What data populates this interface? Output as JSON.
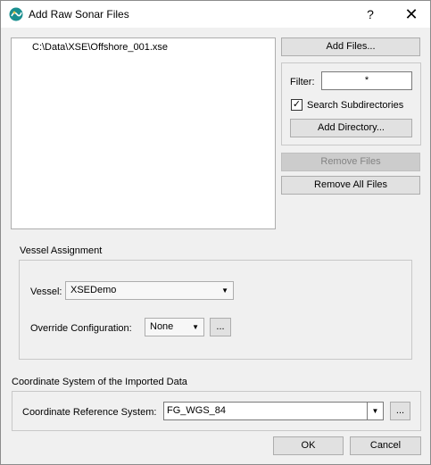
{
  "window": {
    "title": "Add Raw Sonar Files",
    "help": "?",
    "close": "✕"
  },
  "files": {
    "items": [
      "C:\\Data\\XSE\\Offshore_001.xse"
    ]
  },
  "buttons": {
    "add_files": "Add Files...",
    "add_directory": "Add Directory...",
    "remove_files": "Remove Files",
    "remove_all_files": "Remove All Files",
    "ok": "OK",
    "cancel": "Cancel"
  },
  "filter": {
    "label": "Filter:",
    "value": "*",
    "search_subdirectories_label": "Search Subdirectories",
    "search_subdirectories_checked": true,
    "checkmark": "✓"
  },
  "vessel_assignment": {
    "title": "Vessel Assignment",
    "vessel_label": "Vessel:",
    "vessel_value": "XSEDemo",
    "override_label": "Override Configuration:",
    "override_value": "None",
    "browse": "...",
    "arrow": "▼"
  },
  "coordinate_system": {
    "title": "Coordinate System of the Imported Data",
    "crs_label": "Coordinate Reference System:",
    "crs_value": "FG_WGS_84",
    "browse": "...",
    "arrow": "▼"
  }
}
